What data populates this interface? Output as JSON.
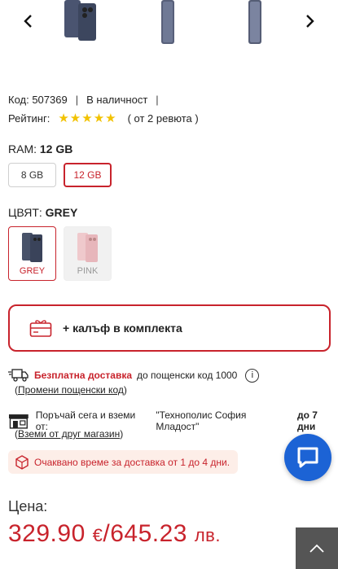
{
  "product": {
    "code_text": "Код: 507369",
    "availability": "В наличност",
    "rating_label": "Рейтинг:",
    "stars": 5,
    "reviews_text": "( от 2 ревюта )"
  },
  "ram": {
    "label": "RAM:",
    "selected": "12 GB",
    "options": [
      "8 GB",
      "12 GB"
    ]
  },
  "color": {
    "label": "ЦВЯТ:",
    "selected": "GREY",
    "options": [
      "GREY",
      "PINK"
    ]
  },
  "bundle": {
    "text": "+ калъф в комплекта"
  },
  "delivery": {
    "free_label": "Безплатна доставка",
    "free_rest": "до пощенски код 1000",
    "change_link": "Промени пощенски код",
    "store_text": "Поръчай сега и вземи от:",
    "store_name": "\"Технополис София Младост\"",
    "store_days": "до 7 дни",
    "other_store_link": "Вземи от друг магазин",
    "eta": "Очаквано време за доставка от 1 до 4 дни."
  },
  "price": {
    "label": "Цена:",
    "eur": "329.90",
    "eur_symbol": "€",
    "bgn": "645.23",
    "bgn_symbol": "лв."
  },
  "colors": {
    "accent": "#c8232c",
    "chat": "#1c63d5"
  }
}
